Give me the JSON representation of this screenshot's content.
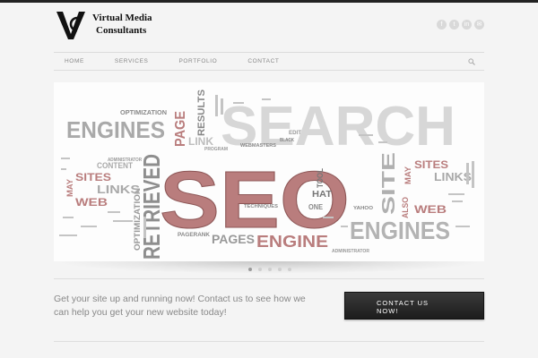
{
  "brand": {
    "name_line1": "Virtual Media",
    "name_line2": "Consultants",
    "monogram": "VMC"
  },
  "social_icons": [
    "social-icon-1",
    "social-icon-2",
    "social-icon-3",
    "social-icon-4"
  ],
  "nav": {
    "items": [
      {
        "label": "HOME"
      },
      {
        "label": "SERVICES"
      },
      {
        "label": "PORTFOLIO"
      },
      {
        "label": "CONTACT"
      }
    ],
    "search_icon": "search-icon"
  },
  "slider": {
    "slide_count": 5,
    "active_slide": 1,
    "words": {
      "search": "SEARCH",
      "seo": "SEO",
      "engines": "ENGINES",
      "retrieved": "RETRIEVED",
      "page": "PAGE",
      "pages": "PAGES",
      "engine": "ENGINE",
      "engines2": "ENGINES",
      "sites": "SITES",
      "sites2": "SITES",
      "links": "LINKS",
      "links2": "LINKS",
      "web": "WEB",
      "web2": "WEB",
      "site": "SITE",
      "optimization": "OPTIMIZATION",
      "optimization2": "OPTIMIZATION",
      "results": "RESULTS",
      "link": "LINK",
      "content": "CONTENT",
      "may": "MAY",
      "may2": "MAY",
      "tool": "TOOL",
      "hat": "HAT",
      "one": "ONE",
      "pagerank": "PAGERANK",
      "webmasters": "WEBMASTERS",
      "techniques": "TECHNIQUES",
      "also": "ALSO",
      "yahoo": "YAHOO",
      "administrator": "ADMINISTRATOR",
      "administrator2": "ADMINISTRATOR",
      "edit": "EDIT",
      "black": "BLACK",
      "program": "PROGRAM"
    }
  },
  "cta": {
    "text": "Get your site up and running now! Contact us to see how we can help you get your new website today!",
    "button_line1": "CONTACT US",
    "button_line2": "NOW!"
  }
}
